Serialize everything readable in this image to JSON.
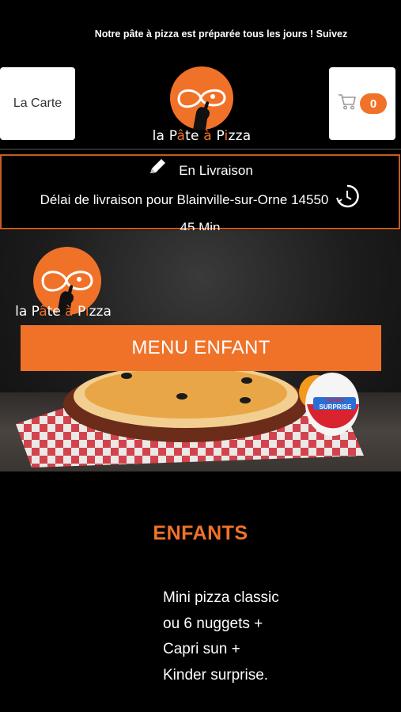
{
  "ticker": {
    "text": "Notre pâte à pizza est préparée tous les jours ! Suivez"
  },
  "header": {
    "menu_label": "La Carte",
    "cart_count": "0",
    "logo_text": {
      "part1": "la P",
      "o1": "â",
      "part2": "te ",
      "o2": "à",
      "part3": " P",
      "o3": "i",
      "part4": "zza"
    }
  },
  "delivery": {
    "mode": "En Livraison",
    "delay_text": "Délai de livraison pour Blainville-sur-Orne 14550",
    "duration": "45 Min"
  },
  "banner": {
    "logo_text": {
      "part1": "la P",
      "o1": "â",
      "part2": "te ",
      "o2": "à",
      "part3": " P",
      "o3": "i",
      "part4": "zza"
    },
    "button_label": "MENU ENFANT",
    "kinder_brand": "Kinder",
    "kinder_label": "SURPRISE"
  },
  "product": {
    "title": "ENFANTS",
    "description_lines": [
      "Mini pizza classic",
      "ou 6 nuggets  +",
      "Capri sun  +",
      "Kinder surprise."
    ]
  },
  "colors": {
    "accent": "#f07228",
    "background": "#000000"
  },
  "icons": [
    "cart-icon",
    "pencil-icon",
    "clock-icon"
  ]
}
